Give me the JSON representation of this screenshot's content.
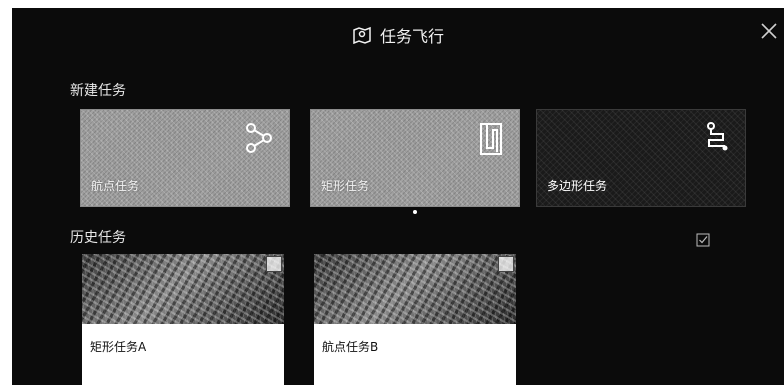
{
  "window": {
    "title": "任务飞行",
    "title_icon": "map-route-icon",
    "close_icon": "close-icon"
  },
  "new_tasks": {
    "label": "新建任务",
    "cards": [
      {
        "label": "航点任务",
        "icon": "waypoint-route-icon",
        "style": "noisy"
      },
      {
        "label": "矩形任务",
        "icon": "rectangle-route-icon",
        "style": "noisy"
      },
      {
        "label": "多边形任务",
        "icon": "polygon-route-icon",
        "style": "dark"
      }
    ]
  },
  "history": {
    "label": "历史任务",
    "select_icon": "checkbox-select-icon",
    "items": [
      {
        "name": "矩形任务A"
      },
      {
        "name": "航点任务B"
      }
    ]
  },
  "colors": {
    "background": "#0b0b0b",
    "text": "#f2f2f2",
    "card_gray": "#9a9a9a",
    "card_dark": "#1a1a1a"
  }
}
